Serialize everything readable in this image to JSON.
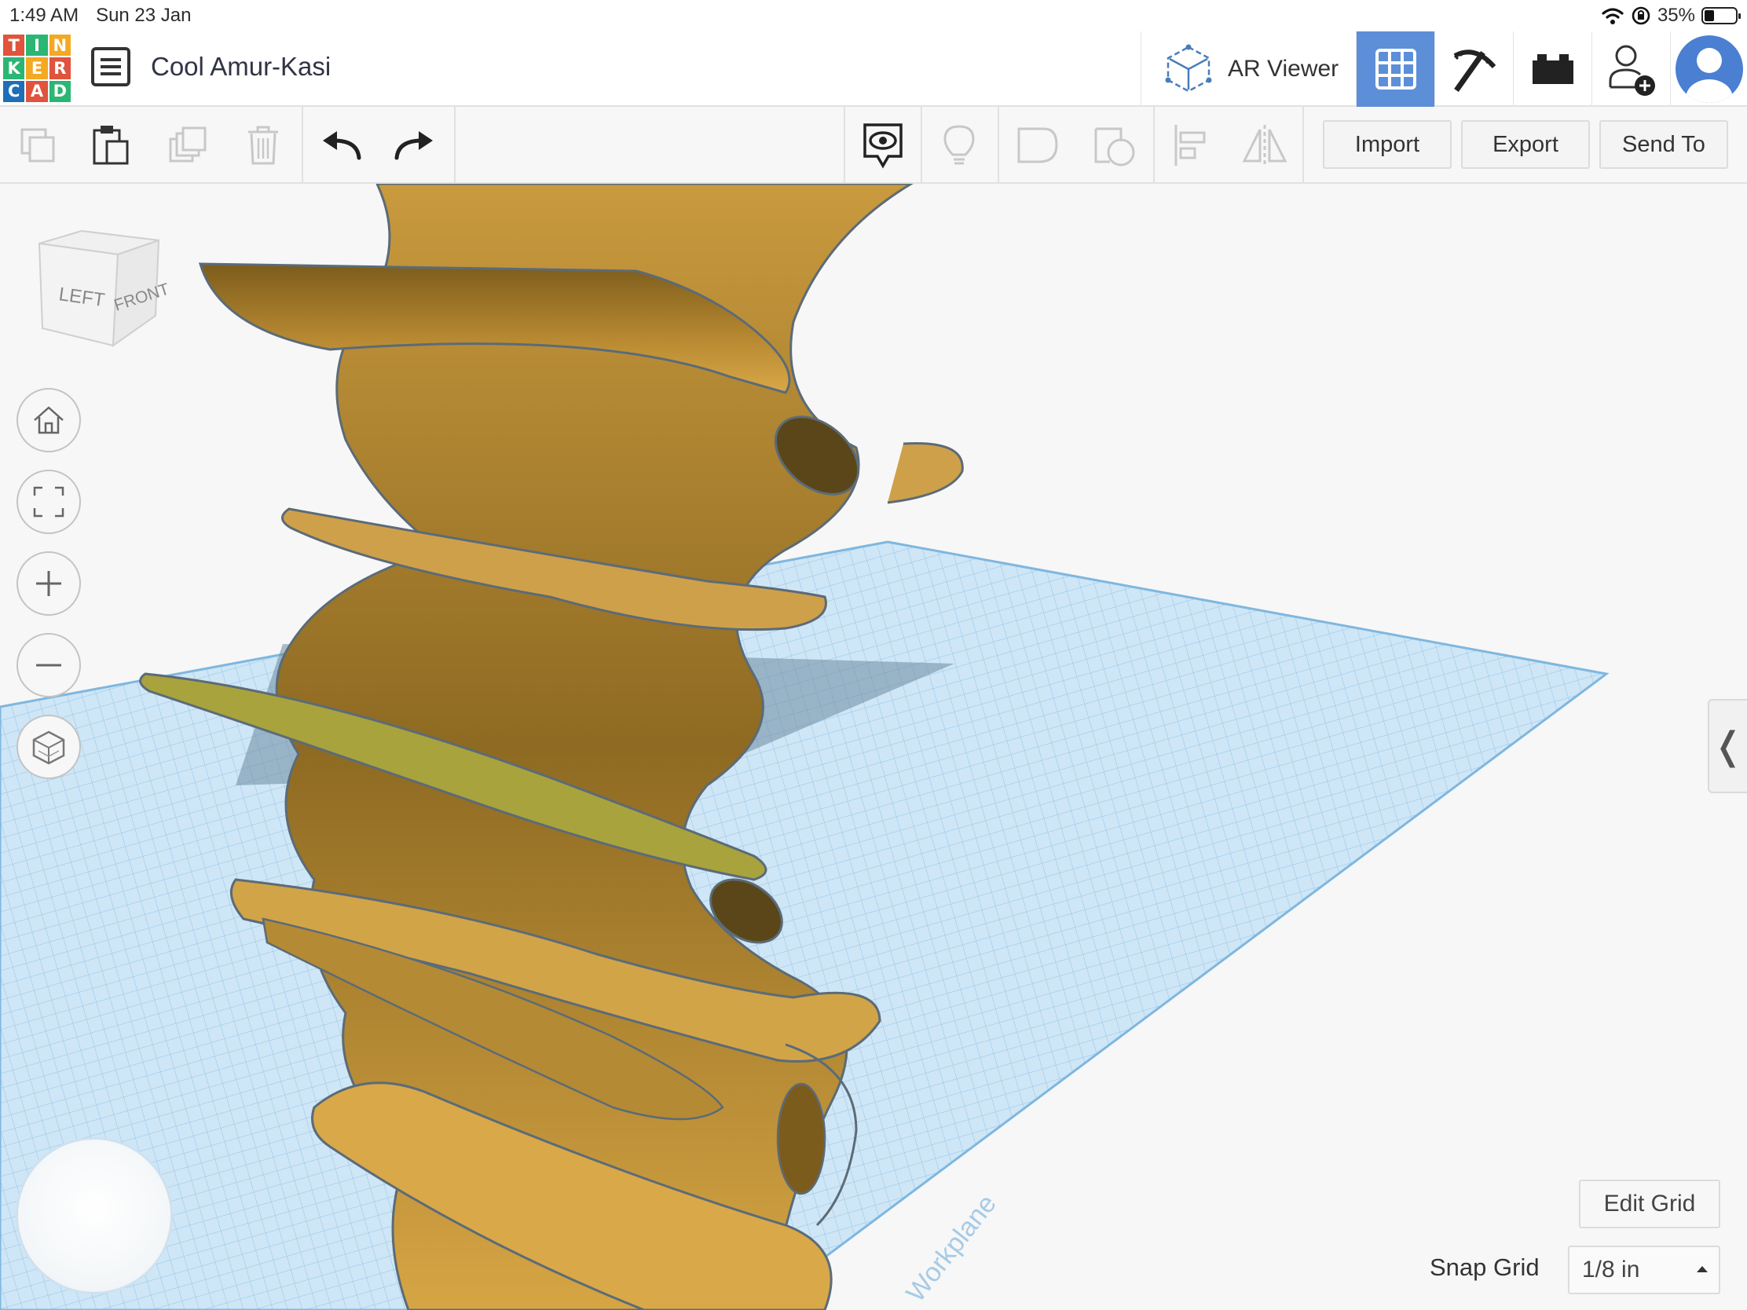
{
  "status_bar": {
    "time": "1:49 AM",
    "date": "Sun 23 Jan",
    "battery": "35%",
    "icons": [
      "wifi-icon",
      "orientation-lock-icon",
      "battery-icon"
    ]
  },
  "header": {
    "logo_letters": [
      "T",
      "I",
      "N",
      "K",
      "E",
      "R",
      "C",
      "A",
      "D"
    ],
    "design_title": "Cool Amur-Kasi",
    "ar_viewer_label": "AR Viewer",
    "view_buttons": [
      "3d-design-grid-icon",
      "pickaxe-icon",
      "bricks-icon",
      "add-user-icon",
      "avatar"
    ],
    "active_view": "3d-design-grid-icon"
  },
  "toolbar": {
    "edit_icons": [
      "copy-icon",
      "paste-icon",
      "duplicate-icon",
      "delete-icon",
      "undo-icon",
      "redo-icon"
    ],
    "view_icons": [
      "notes-visibility-icon",
      "light-bulb-icon",
      "group-icon",
      "ungroup-icon",
      "align-icon",
      "mirror-icon"
    ],
    "import_label": "Import",
    "export_label": "Export",
    "send_to_label": "Send To"
  },
  "viewcube": {
    "left_label": "LEFT",
    "front_label": "FRONT"
  },
  "view_controls": [
    "home-view-icon",
    "fit-view-icon",
    "zoom-in-icon",
    "zoom-out-icon",
    "perspective-icon"
  ],
  "workplane": {
    "edit_grid_label": "Edit Grid",
    "snap_grid_label": "Snap Grid",
    "snap_grid_value": "1/8 in",
    "watermark": "Workplane"
  },
  "colors": {
    "accent": "#5d8fd9",
    "model": "#d7a540",
    "grid": "#a9d3ee",
    "background": "#f7f7f7"
  }
}
